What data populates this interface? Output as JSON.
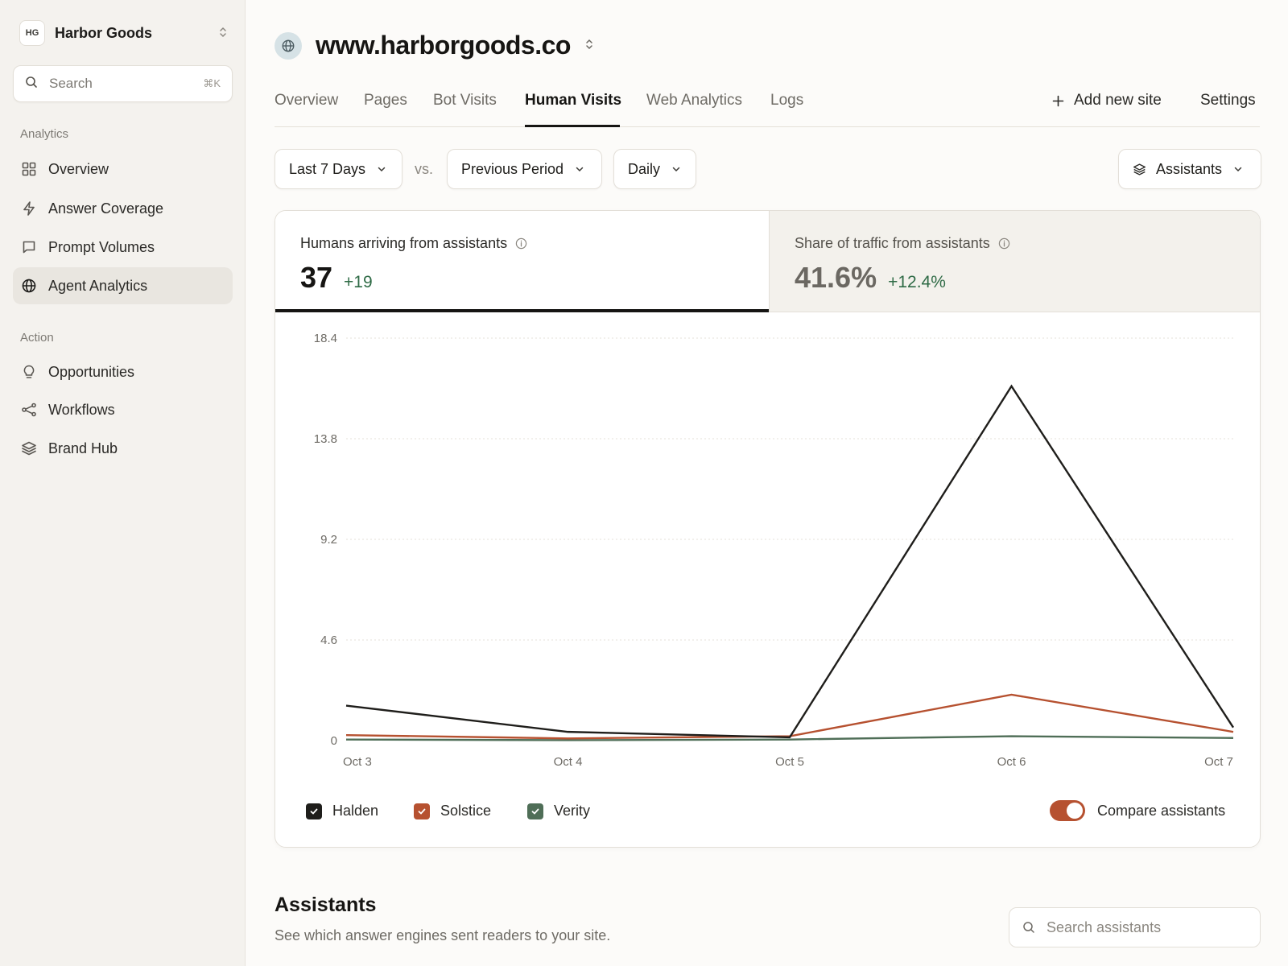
{
  "workspace": {
    "badge": "HG",
    "name": "Harbor Goods"
  },
  "search": {
    "placeholder": "Search",
    "shortcut": "⌘K"
  },
  "sidebar": {
    "analytics_label": "Analytics",
    "analytics_items": [
      {
        "label": "Overview",
        "icon": "grid-icon"
      },
      {
        "label": "Answer Coverage",
        "icon": "bolt-icon"
      },
      {
        "label": "Prompt Volumes",
        "icon": "chat-icon"
      },
      {
        "label": "Agent Analytics",
        "icon": "globe-icon",
        "active": true
      }
    ],
    "action_label": "Action",
    "action_items": [
      {
        "label": "Opportunities",
        "icon": "lightbulb-icon"
      },
      {
        "label": "Workflows",
        "icon": "share-nodes-icon"
      },
      {
        "label": "Brand Hub",
        "icon": "layers-icon"
      }
    ]
  },
  "site": {
    "name": "www.harborgoods.co"
  },
  "tabs": [
    "Overview",
    "Pages",
    "Bot Visits",
    "Human Visits",
    "Web Analytics",
    "Logs"
  ],
  "active_tab": "Human Visits",
  "tab_actions": {
    "add_site": "Add new site",
    "settings": "Settings"
  },
  "filters": {
    "range": "Last 7 Days",
    "vs": "vs.",
    "compare": "Previous Period",
    "granularity": "Daily",
    "segment": "Assistants"
  },
  "stats": [
    {
      "label": "Humans arriving from assistants",
      "value": "37",
      "delta": "+19"
    },
    {
      "label": "Share of traffic from assistants",
      "value": "41.6%",
      "delta": "+12.4%"
    }
  ],
  "chart_data": {
    "type": "line",
    "x": [
      "Oct 3",
      "Oct 4",
      "Oct 5",
      "Oct 6",
      "Oct 7"
    ],
    "y_ticks": [
      "18.4",
      "13.8",
      "9.2",
      "4.6",
      "0"
    ],
    "ylim": [
      0,
      18.4
    ],
    "grid": true,
    "legend_position": "bottom-left",
    "series": [
      {
        "name": "Halden",
        "color": "#1f1e1b",
        "values": [
          1.6,
          0.4,
          0.15,
          16.2,
          0.6
        ]
      },
      {
        "name": "Solstice",
        "color": "#b65130",
        "values": [
          0.25,
          0.1,
          0.2,
          2.1,
          0.4
        ]
      },
      {
        "name": "Verity",
        "color": "#4f6e57",
        "values": [
          0.05,
          0.02,
          0.05,
          0.2,
          0.12
        ]
      }
    ]
  },
  "compare_toggle": {
    "label": "Compare assistants",
    "on": true
  },
  "assistants_section": {
    "title": "Assistants",
    "subtitle": "See which answer engines sent readers to your site.",
    "search_placeholder": "Search assistants"
  }
}
